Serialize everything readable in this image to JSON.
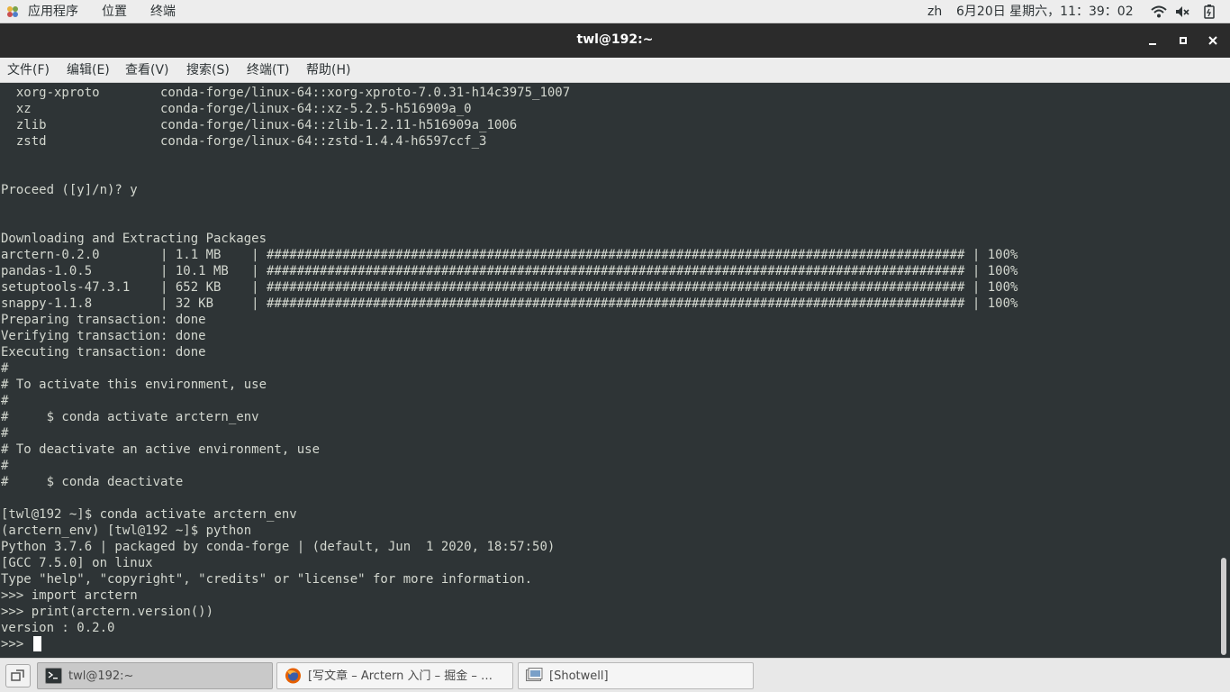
{
  "top_panel": {
    "applications": "应用程序",
    "places": "位置",
    "terminal": "终端",
    "input_method": "zh",
    "datetime": "6月20日 星期六，11：39：02"
  },
  "window": {
    "title": "twl@192:~"
  },
  "menu": {
    "file": "文件(F)",
    "edit": "编辑(E)",
    "view": "查看(V)",
    "search": "搜索(S)",
    "terminal": "终端(T)",
    "help": "帮助(H)"
  },
  "terminal": {
    "lines": [
      "  xorg-xproto        conda-forge/linux-64::xorg-xproto-7.0.31-h14c3975_1007",
      "  xz                 conda-forge/linux-64::xz-5.2.5-h516909a_0",
      "  zlib               conda-forge/linux-64::zlib-1.2.11-h516909a_1006",
      "  zstd               conda-forge/linux-64::zstd-1.4.4-h6597ccf_3",
      "",
      "",
      "Proceed ([y]/n)? y",
      "",
      "",
      "Downloading and Extracting Packages",
      "arctern-0.2.0        | 1.1 MB    | ############################################################################################ | 100%",
      "pandas-1.0.5         | 10.1 MB   | ############################################################################################ | 100%",
      "setuptools-47.3.1    | 652 KB    | ############################################################################################ | 100%",
      "snappy-1.1.8         | 32 KB     | ############################################################################################ | 100%",
      "Preparing transaction: done",
      "Verifying transaction: done",
      "Executing transaction: done",
      "#",
      "# To activate this environment, use",
      "#",
      "#     $ conda activate arctern_env",
      "#",
      "# To deactivate an active environment, use",
      "#",
      "#     $ conda deactivate",
      "",
      "[twl@192 ~]$ conda activate arctern_env",
      "(arctern_env) [twl@192 ~]$ python",
      "Python 3.7.6 | packaged by conda-forge | (default, Jun  1 2020, 18:57:50)",
      "[GCC 7.5.0] on linux",
      "Type \"help\", \"copyright\", \"credits\" or \"license\" for more information.",
      ">>> import arctern",
      ">>> print(arctern.version())",
      "version : 0.2.0",
      ">>> "
    ]
  },
  "taskbar": {
    "tasks": [
      {
        "label": "twl@192:~",
        "icon": "terminal-icon"
      },
      {
        "label": "[写文章 – Arctern 入门 – 掘金 – …",
        "icon": "firefox-icon"
      },
      {
        "label": "[Shotwell]",
        "icon": "shotwell-icon"
      }
    ]
  }
}
